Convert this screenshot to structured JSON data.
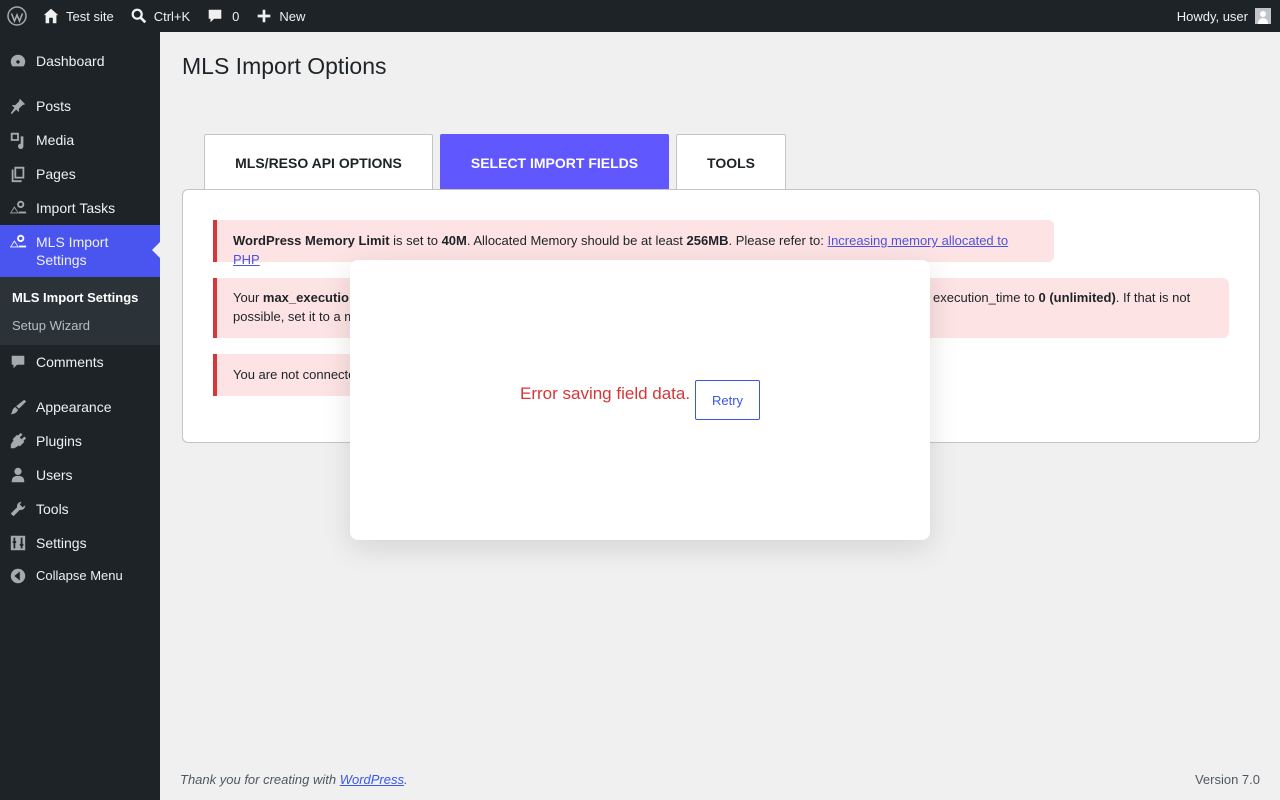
{
  "adminbar": {
    "site_name": "Test site",
    "search_shortcut": "Ctrl+K",
    "comments_count": "0",
    "new_label": "New",
    "howdy": "Howdy, user"
  },
  "sidebar": {
    "items": [
      {
        "label": "Dashboard",
        "icon": "dashboard-icon"
      },
      {
        "label": "Posts",
        "icon": "pin-icon"
      },
      {
        "label": "Media",
        "icon": "media-icon"
      },
      {
        "label": "Pages",
        "icon": "pages-icon"
      },
      {
        "label": "Import Tasks",
        "icon": "house-icon"
      },
      {
        "label": "MLS Import Settings",
        "icon": "house-icon"
      },
      {
        "label": "Comments",
        "icon": "comment-icon"
      },
      {
        "label": "Appearance",
        "icon": "brush-icon"
      },
      {
        "label": "Plugins",
        "icon": "plug-icon"
      },
      {
        "label": "Users",
        "icon": "user-icon"
      },
      {
        "label": "Tools",
        "icon": "wrench-icon"
      },
      {
        "label": "Settings",
        "icon": "sliders-icon"
      },
      {
        "label": "Collapse Menu",
        "icon": "collapse-icon"
      }
    ],
    "submenu": [
      "MLS Import Settings",
      "Setup Wizard"
    ]
  },
  "page": {
    "title": "MLS Import Options",
    "tabs": [
      "MLS/RESO API OPTIONS",
      "SELECT IMPORT FIELDS",
      "TOOLS"
    ],
    "active_tab": "SELECT IMPORT FIELDS"
  },
  "notices": {
    "memory": {
      "b1": "WordPress Memory Limit",
      "t1": " is set to ",
      "b2": "40M",
      "t2": ". Allocated Memory should be at least ",
      "b3": "256MB",
      "t3": ". Please refer to: ",
      "link": "Increasing memory allocated to PHP"
    },
    "exec": {
      "left_t1": "Your ",
      "left_b1": "max_executio",
      "left_line2": "possible, set it to a m",
      "right_t1": "execution_time to ",
      "right_b1": "0 (unlimited)",
      "right_t2": ". If that is not"
    },
    "connect": {
      "left": "You are not connecte"
    }
  },
  "modal": {
    "message": "Error saving field data.",
    "retry_label": "Retry"
  },
  "footer": {
    "thanks_prefix": "Thank you for creating with ",
    "thanks_link": "WordPress",
    "thanks_suffix": ".",
    "version": "Version 7.0"
  },
  "colors": {
    "accent": "#4a55f0",
    "active_tab": "#6157ff",
    "error": "#d63638",
    "notice_bg": "#fde3e3"
  }
}
